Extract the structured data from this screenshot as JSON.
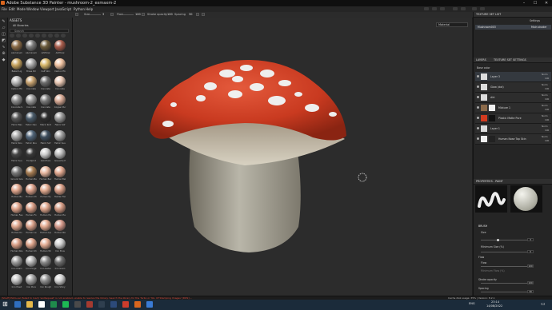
{
  "window": {
    "title": "Adobe Substance 3D Painter - mushroom-2_exmaxm-2",
    "controls": [
      "–",
      "☐",
      "✕"
    ]
  },
  "menu": [
    "File",
    "Edit",
    "Mode",
    "Window",
    "Viewport",
    "JavaScript",
    "Python",
    "Help"
  ],
  "toolbar": {
    "size_label": "Size",
    "size_value": "3",
    "flow_label": "Flow",
    "flow_value": "100",
    "stroke_label": "Stroke opacity",
    "stroke_value": "100",
    "spacing_label": "Spacing",
    "spacing_value": "30"
  },
  "assets": {
    "title": "ASSETS",
    "library": "All libraries",
    "search_placeholder": "Search",
    "rows": [
      {
        "colors": [
          "#8a6a45",
          "#7c7c7c",
          "#6a5a3a",
          "#a85b4a"
        ],
        "captions": [
          "Aluminium",
          "Aluminium",
          "Artificial",
          "Artificial"
        ]
      },
      {
        "colors": [
          "#c8a45e",
          "#a8a8a8",
          "#d8b86a",
          "#f0c2a0"
        ],
        "captions": [
          "Baked Lig",
          "Brass Pol",
          "Calf Skin",
          "Carbon Fib"
        ]
      },
      {
        "colors": [
          "#b9b9b9",
          "#c7a270",
          "#6c6c6c",
          "#e9c8b4"
        ],
        "captions": [
          "Carbon Fib",
          "Concrete",
          "Concrete",
          "Concrete"
        ]
      },
      {
        "colors": [
          "#8d8d8d",
          "#9a9a9a",
          "#7a7a7a",
          "#d7a994"
        ],
        "captions": [
          "Concrete S",
          "Concrete",
          "Concrete",
          "Copper Pur"
        ]
      },
      {
        "colors": [
          "#555555",
          "#4a5b6a",
          "#2d2d2d",
          "#9a9a9a"
        ],
        "captions": [
          "Fabric Bas",
          "Fabric Den",
          "Fabric Knit",
          "Fabric Sof"
        ]
      },
      {
        "colors": [
          "#a8a8a8",
          "#506478",
          "#3c4c5c",
          "#a0a0a0"
        ],
        "captions": [
          "Fabric Rou",
          "Fabric Rou",
          "Fabric Sof",
          "Fabric Sua"
        ]
      },
      {
        "colors": [
          "#444444",
          "#383838",
          "#cccccc",
          "#bdbdbd"
        ],
        "captions": [
          "Fabric Sua",
          "Footprint",
          "Gold Pure",
          "Gouache P"
        ]
      },
      {
        "colors": [
          "#787878",
          "#a67c52",
          "#e8b8a0",
          "#e2a88f"
        ],
        "captions": [
          "Ground Gra",
          "Human Ba",
          "Human Bac",
          "Human Bel"
        ]
      },
      {
        "colors": [
          "#e0a58c",
          "#dba089",
          "#e1a98e",
          "#d99e86"
        ],
        "captions": [
          "Human Bu",
          "Human Ch",
          "Human Ey",
          "Human Fac"
        ]
      },
      {
        "colors": [
          "#e0a38a",
          "#d79c84",
          "#dea58c",
          "#d49a83"
        ],
        "captions": [
          "Human Fee",
          "Human Fo",
          "Human Ha",
          "Human He"
        ]
      },
      {
        "colors": [
          "#dfa68d",
          "#d8a089",
          "#e3aa90",
          "#d5998a"
        ],
        "captions": [
          "Human Kn",
          "Human Le",
          "Human Lip",
          "Human Ne"
        ]
      },
      {
        "colors": [
          "#d99e86",
          "#dca38a",
          "#e4ad94",
          "#cfcfcf"
        ],
        "captions": [
          "Human Nos",
          "Human Sh",
          "Human Wr",
          "Iron Brus"
        ]
      },
      {
        "colors": [
          "#9a9a9a",
          "#b5b5b5",
          "#888888",
          "#6d6d6d"
        ],
        "captions": [
          "Iron Chain",
          "Iron Forge",
          "Iron Galva",
          "Iron Grain"
        ]
      },
      {
        "colors": [
          "#c4c4c4",
          "#a2a2a2",
          "#8f8f8f",
          "#d3d3d3"
        ],
        "captions": [
          "Iron Powd",
          "Iron Pure",
          "Iron Rough",
          "Iron Shiny"
        ]
      }
    ]
  },
  "viewport": {
    "mode_select": "Material"
  },
  "texture_set_list": {
    "title": "TEXTURE SET LIST",
    "settings_label": "Settings",
    "item_name": "Mushroom003",
    "item_shader": "Main shader"
  },
  "layers": {
    "tabs": [
      "LAYERS",
      "TEXTURE SET SETTINGS"
    ],
    "channel": "Base color",
    "items": [
      {
        "name": "Layer 3",
        "blend": "Norm",
        "opacity": "100",
        "thumb": "#dcdcdc",
        "mask": ""
      },
      {
        "name": "Glow (dot)",
        "blend": "Norm",
        "opacity": "100",
        "thumb": "#dcdcdc",
        "mask": ""
      },
      {
        "name": "dirt",
        "blend": "Norm",
        "opacity": "100",
        "thumb": "#dcdcdc",
        "mask": ""
      },
      {
        "name": "Mixture 1",
        "blend": "Norm",
        "opacity": "100",
        "thumb": "#8b6a4a",
        "mask": "#f2f2f2"
      },
      {
        "name": "Plastic Matte Pure",
        "blend": "Norm",
        "opacity": "100",
        "thumb": "#d23b1f",
        "mask": "#111111"
      },
      {
        "name": "Layer 1",
        "blend": "Norm",
        "opacity": "100",
        "thumb": "#dcdcdc",
        "mask": ""
      },
      {
        "name": "Human Nose Top Skin",
        "blend": "Norm",
        "opacity": "100",
        "thumb": "#f0f0f0",
        "mask": "#222222"
      }
    ]
  },
  "properties": {
    "title": "PROPERTIES - PAINT",
    "section": "BRUSH",
    "size_label": "Size",
    "size_value": "3",
    "min_size_label": "Minimum Size (%)",
    "min_size_value": "0",
    "flow_section": "Flow",
    "flow_label": "Flow",
    "flow_value": "100",
    "min_flow_label": "Minimum Flow (%)",
    "stroke_label": "Stroke opacity",
    "stroke_value": "100",
    "spacing_label": "Spacing",
    "spacing_value": "30"
  },
  "status": {
    "error": "[Shelf] PLUG-ssl (failed to load) 'ssl.Request' is not enabled, unable to resolve the library. Search the library for the Turbo or 'No. Of Stamping Images' [DDS] ...",
    "info": "Cache disk usage:   35%   |   Version: 8.2.1"
  },
  "taskbar": {
    "lang": "ENG",
    "time": "23:14",
    "date": "14/08/2022",
    "apps": [
      "#2f6fbf",
      "#e6b94a",
      "#ffffff",
      "#1f8b4c",
      "#1db954",
      "#4a4a4a",
      "#a33a30",
      "#2f3f4f",
      "#2c4a7a",
      "#cc3c2c",
      "#d9661e",
      "#3a7bd5"
    ]
  }
}
